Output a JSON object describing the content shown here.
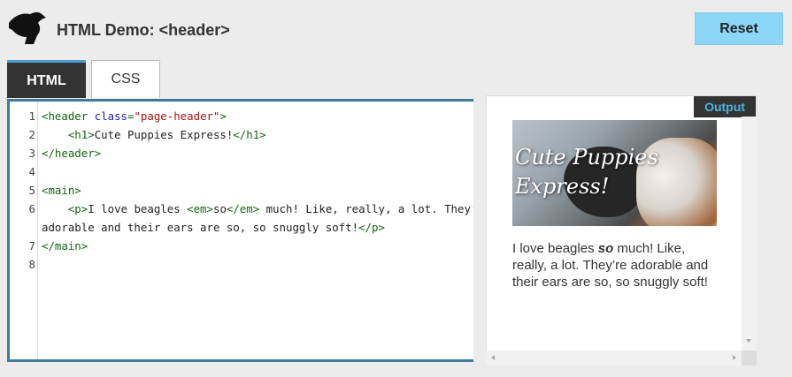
{
  "header": {
    "logo_icon": "dinosaur-head-logo-icon",
    "title": "HTML Demo: <header>",
    "reset_label": "Reset"
  },
  "tabs": [
    {
      "label": "HTML",
      "active": true
    },
    {
      "label": "CSS",
      "active": false
    }
  ],
  "editor": {
    "lines": [
      {
        "n": "1",
        "parts": [
          [
            "tag",
            "<header "
          ],
          [
            "attr",
            "class"
          ],
          [
            "tag",
            "="
          ],
          [
            "str",
            "\"page-header\""
          ],
          [
            "tag",
            ">"
          ]
        ]
      },
      {
        "n": "2",
        "parts": [
          [
            "text",
            "    "
          ],
          [
            "tag",
            "<h1>"
          ],
          [
            "text",
            "Cute Puppies Express!"
          ],
          [
            "tag",
            "</h1>"
          ]
        ]
      },
      {
        "n": "3",
        "parts": [
          [
            "tag",
            "</header>"
          ]
        ]
      },
      {
        "n": "4",
        "parts": []
      },
      {
        "n": "5",
        "parts": [
          [
            "tag",
            "<main>"
          ]
        ]
      },
      {
        "n": "6",
        "parts": [
          [
            "text",
            "    "
          ],
          [
            "tag",
            "<p>"
          ],
          [
            "text",
            "I love beagles "
          ],
          [
            "tag",
            "<em>"
          ],
          [
            "text",
            "so"
          ],
          [
            "tag",
            "</em>"
          ],
          [
            "text",
            " much! Like, really, a lot. They’ re"
          ]
        ]
      },
      {
        "n": "",
        "parts": [
          [
            "text",
            "adorable and their ears are so, so snuggly soft!"
          ],
          [
            "tag",
            "</p>"
          ]
        ]
      },
      {
        "n": "7",
        "parts": [
          [
            "tag",
            "</main>"
          ]
        ]
      },
      {
        "n": "8",
        "parts": []
      }
    ]
  },
  "output": {
    "label": "Output",
    "heading": "Cute Puppies Express!",
    "para_before": "I love beagles ",
    "para_em": "so",
    "para_after": " much! Like, really, a lot. They’re adorable and their ears are so, so snuggly soft!"
  },
  "colors": {
    "accent_tab_border": "#4d9ed6",
    "reset_button": "#8cd7f7",
    "editor_border": "#3d7a9c",
    "output_label_text": "#4fb3e0"
  }
}
